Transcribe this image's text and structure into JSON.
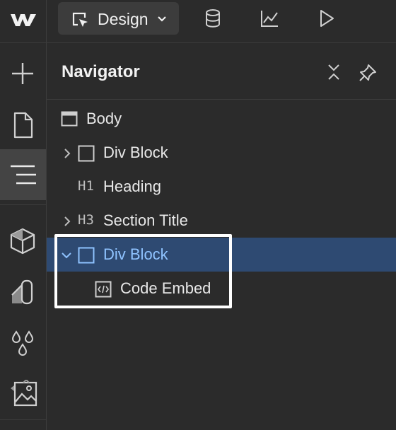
{
  "toolbar": {
    "mode_label": "Design",
    "icons": [
      "webflow-logo-icon",
      "cursor-select-icon",
      "chevron-down-icon",
      "database-icon",
      "chart-icon",
      "play-icon"
    ]
  },
  "sidebar": {
    "items": [
      {
        "icon": "plus-icon"
      },
      {
        "icon": "page-icon"
      },
      {
        "icon": "navigator-icon",
        "active": true
      },
      {
        "icon": "cube-icon"
      },
      {
        "icon": "style-manager-icon"
      },
      {
        "icon": "droplets-icon"
      },
      {
        "icon": "assets-image-icon"
      }
    ]
  },
  "navigator": {
    "title": "Navigator",
    "header_icons": [
      "collapse-icon",
      "pin-icon"
    ],
    "nodes": [
      {
        "label": "Body",
        "type": "body"
      },
      {
        "label": "Div Block",
        "type": "div",
        "collapsible": true
      },
      {
        "label": "Heading",
        "type": "h1",
        "tag": "H1"
      },
      {
        "label": "Section Title",
        "type": "h3",
        "tag": "H3",
        "collapsible": true
      },
      {
        "label": "Div Block",
        "type": "div",
        "collapsible": true,
        "expanded": true,
        "selected": true
      },
      {
        "label": "Code Embed",
        "type": "embed"
      }
    ]
  },
  "colors": {
    "background": "#2b2b2b",
    "selected_row": "#2e4a72",
    "selected_text": "#8fc3ff",
    "highlight_border": "#ffffff"
  }
}
